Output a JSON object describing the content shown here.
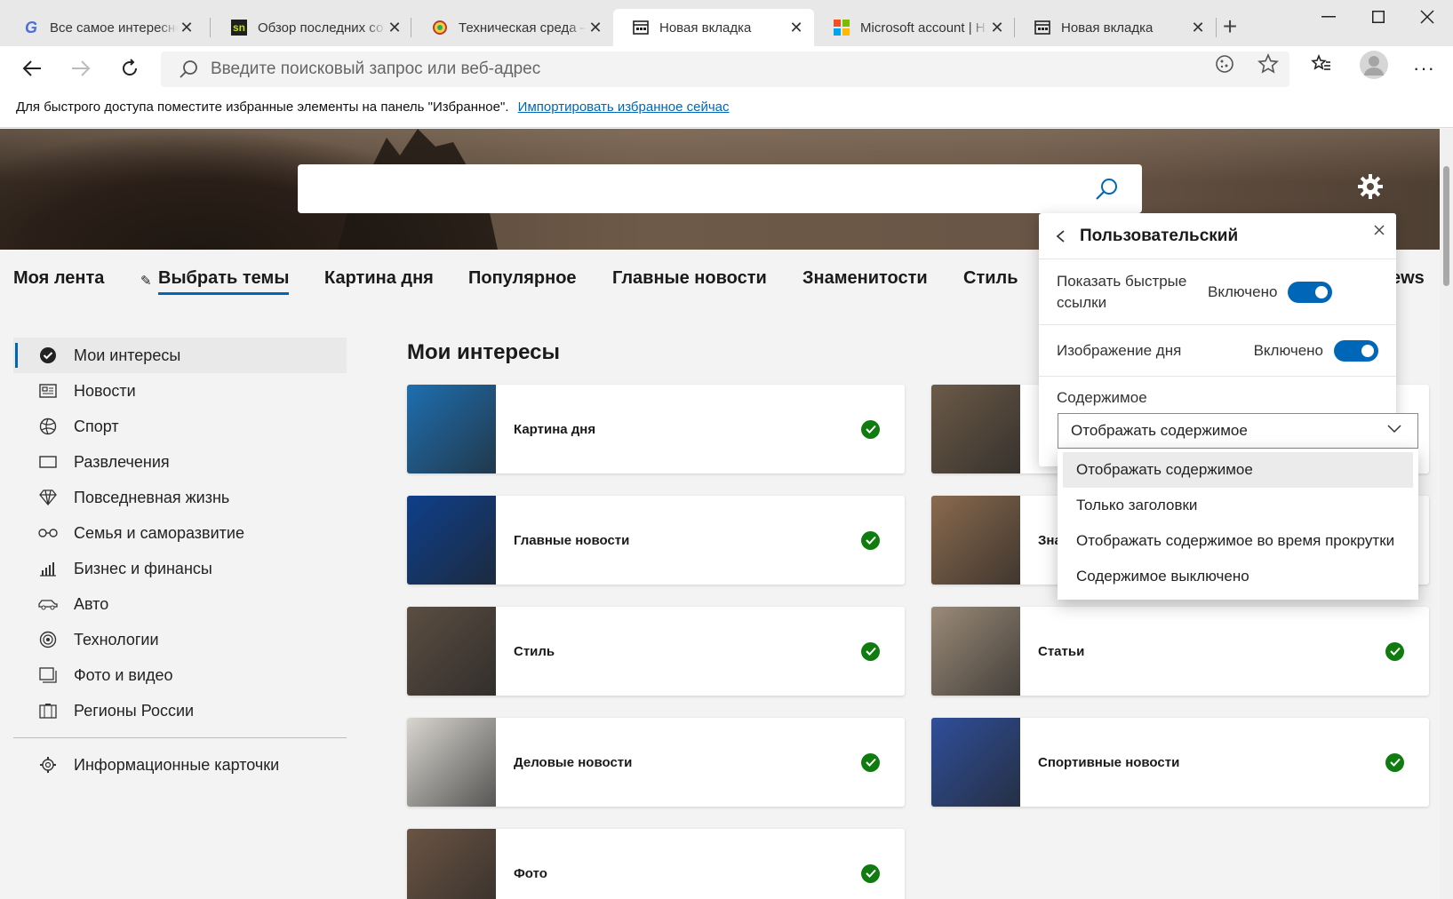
{
  "tabs": [
    {
      "title": "Все самое интересное",
      "favicon": "G",
      "favicon_color": "#4a6fd8"
    },
    {
      "title": "Обзор последних со",
      "favicon": "sn",
      "favicon_color": "#2a2a2a"
    },
    {
      "title": "Техническая среда –",
      "favicon": "globe-icon",
      "favicon_color": "#c0392b"
    },
    {
      "title": "Новая вкладка",
      "favicon": "newtab-icon",
      "active": true
    },
    {
      "title": "Microsoft account | H",
      "favicon": "ms-logo"
    },
    {
      "title": "Новая вкладка",
      "favicon": "newtab-icon"
    }
  ],
  "address": {
    "placeholder": "Введите поисковый запрос или веб-адрес"
  },
  "favbar": {
    "text": "Для быстрого доступа поместите избранные элементы на панель \"Избранное\".",
    "link": "Импортировать избранное сейчас"
  },
  "categories": [
    "Моя лента",
    "Выбрать темы",
    "Картина дня",
    "Популярное",
    "Главные новости",
    "Знаменитости",
    "Стиль",
    "ews"
  ],
  "sidebar": {
    "items": [
      {
        "label": "Мои интересы",
        "icon": "check-circle-icon",
        "selected": true
      },
      {
        "label": "Новости",
        "icon": "newspaper-icon"
      },
      {
        "label": "Спорт",
        "icon": "ball-icon"
      },
      {
        "label": "Развлечения",
        "icon": "screen-icon"
      },
      {
        "label": "Повседневная жизнь",
        "icon": "diamond-icon"
      },
      {
        "label": "Семья и саморазвитие",
        "icon": "glasses-icon"
      },
      {
        "label": "Бизнес и финансы",
        "icon": "chart-icon"
      },
      {
        "label": "Авто",
        "icon": "car-icon"
      },
      {
        "label": "Технологии",
        "icon": "tech-icon"
      },
      {
        "label": "Фото и видео",
        "icon": "photo-icon"
      },
      {
        "label": "Регионы России",
        "icon": "building-icon"
      }
    ],
    "bottom": {
      "label": "Информационные карточки",
      "icon": "gear-icon"
    }
  },
  "main": {
    "title": "Мои интересы",
    "cards": [
      {
        "title": "Картина дня",
        "color": "#1e6fb0"
      },
      {
        "title": "",
        "color": "#6b5a48"
      },
      {
        "title": "Главные новости",
        "color": "#0f3f8a"
      },
      {
        "title": "Зна",
        "color": "#8a6a4e"
      },
      {
        "title": "Стиль",
        "color": "#5b4e42"
      },
      {
        "title": "Статьи",
        "color": "#9a8a78"
      },
      {
        "title": "Деловые новости",
        "color": "#d9d6d0"
      },
      {
        "title": "Спортивные новости",
        "color": "#2f4f9a"
      },
      {
        "title": "Фото",
        "color": "#6a5444"
      }
    ]
  },
  "panel": {
    "title": "Пользовательский",
    "rows": [
      {
        "label": "Показать быстрые ссылки",
        "status": "Включено"
      },
      {
        "label": "Изображение дня",
        "status": "Включено"
      }
    ],
    "content_label": "Содержимое",
    "select_value": "Отображать содержимое",
    "options": [
      "Отображать содержимое",
      "Только заголовки",
      "Отображать содержимое во время прокрутки",
      "Содержимое выключено"
    ]
  },
  "colors": {
    "accent": "#0067b8",
    "check": "#107c10"
  }
}
